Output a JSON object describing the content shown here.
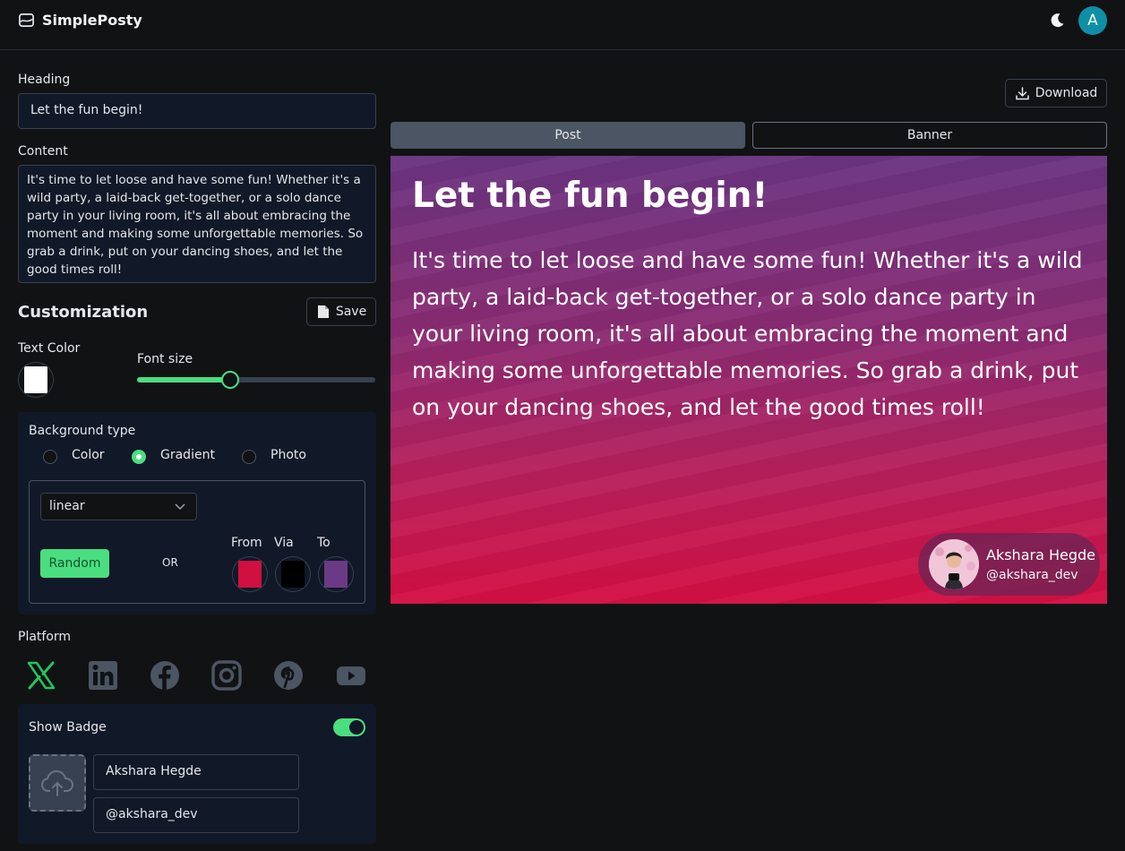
{
  "app": {
    "name": "SimplePosty",
    "avatar_letter": "A",
    "accent": "#4ade80",
    "avatar_color": "#0e8fa6"
  },
  "form": {
    "heading_label": "Heading",
    "heading_value": "Let the fun begin!",
    "content_label": "Content",
    "content_value": "It's time to let loose and have some fun! Whether it's a wild party, a laid-back get-together, or a solo dance party in your living room, it's all about embracing the moment and making some unforgettable memories. So grab a drink, put on your dancing shoes, and let the good times roll!"
  },
  "customization": {
    "title": "Customization",
    "save_label": "Save",
    "text_color_label": "Text Color",
    "text_color": "#ffffff",
    "font_size_label": "Font size",
    "font_size_fraction": 0.39
  },
  "background": {
    "label": "Background type",
    "options": [
      "Color",
      "Gradient",
      "Photo"
    ],
    "selected": "Gradient",
    "gradient_type": "linear",
    "random_label": "Random",
    "or_label": "OR",
    "from_label": "From",
    "via_label": "Via",
    "to_label": "To",
    "from_color": "#d0103f",
    "via_color": "#000000",
    "to_color": "#6b3a86"
  },
  "platform": {
    "label": "Platform",
    "items": [
      "x-icon",
      "linkedin-icon",
      "facebook-icon",
      "instagram-icon",
      "pinterest-icon",
      "youtube-icon"
    ],
    "selected": "x-icon"
  },
  "badge": {
    "label": "Show Badge",
    "enabled": true,
    "name": "Akshara Hegde",
    "handle": "@akshara_dev"
  },
  "toolbar": {
    "download_label": "Download"
  },
  "tabs": {
    "post": "Post",
    "banner": "Banner",
    "active": "Post"
  }
}
